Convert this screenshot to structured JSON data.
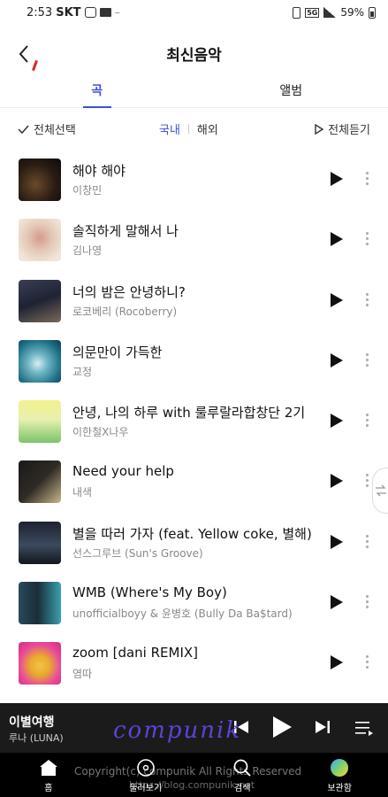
{
  "status_bar": {
    "time": "2:53",
    "carrier": "SKT",
    "battery": "59%",
    "network": "5G"
  },
  "header": {
    "title": "최신음악"
  },
  "tabs": [
    {
      "label": "곡",
      "active": true
    },
    {
      "label": "앨범",
      "active": false
    }
  ],
  "filters": {
    "select_all": "전체선택",
    "region_domestic": "국내",
    "region_foreign": "해외",
    "play_all": "전체듣기"
  },
  "songs": [
    {
      "title": "해야 해야",
      "artist": "이창민"
    },
    {
      "title": "솔직하게 말해서 나",
      "artist": "김나영"
    },
    {
      "title": "너의 밤은 안녕하니?",
      "artist": "로코베리 (Rocoberry)"
    },
    {
      "title": "의문만이 가득한",
      "artist": "교정"
    },
    {
      "title": "안녕, 나의 하루 with 룰루랄라합창단 2기",
      "artist": "이한철X나우"
    },
    {
      "title": "Need your help",
      "artist": "내색"
    },
    {
      "title": "별을 따러 가자 (feat. Yellow coke, 별해)",
      "artist": "선스그루브 (Sun's Groove)"
    },
    {
      "title": "WMB (Where's My Boy)",
      "artist": "unofficialboyy & 윤병호 (Bully Da Ba$tard)"
    },
    {
      "title": "zoom [dani REMIX]",
      "artist": "염따"
    }
  ],
  "player": {
    "title": "이별여행",
    "artist": "루나 (LUNA)"
  },
  "bottom_nav": [
    {
      "label": "홈",
      "icon": "home-icon"
    },
    {
      "label": "둘러보기",
      "icon": "disc-icon"
    },
    {
      "label": "검색",
      "icon": "search-icon"
    },
    {
      "label": "보관함",
      "icon": "library-icon"
    }
  ],
  "watermark": {
    "script": "compunik",
    "copyright": "Copyright(c) compunik All Rights Reserved",
    "url": "https://blog.compunik.net"
  },
  "colors": {
    "accent": "#3f4ee0",
    "player_bg": "#1b1b1b",
    "nav_bg": "#000000"
  }
}
